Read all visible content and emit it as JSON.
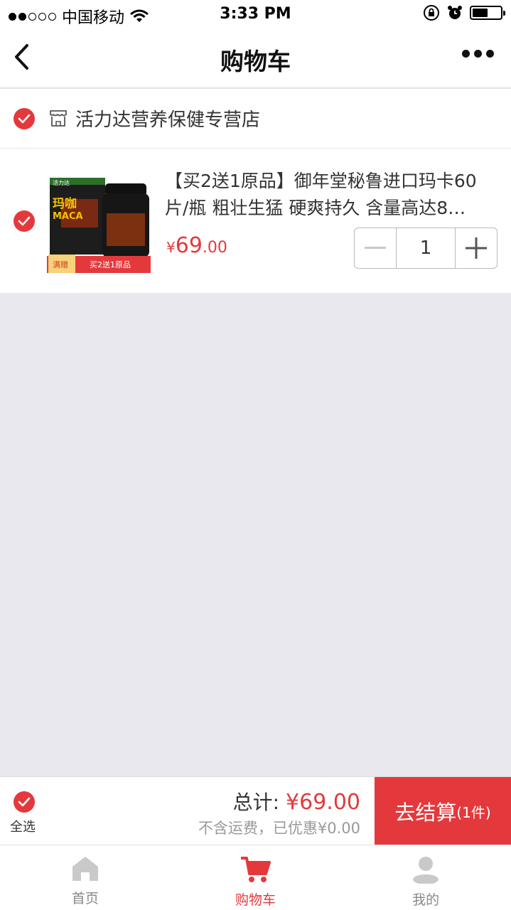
{
  "status_bar": {
    "carrier": "中国移动",
    "time": "3:33 PM"
  },
  "nav": {
    "title": "购物车",
    "back_icon": "chevron-left-icon",
    "more_icon": "more-dots-icon"
  },
  "shop": {
    "name": "活力达营养保健专营店",
    "checked": true
  },
  "item": {
    "title": "【买2送1原品】御年堂秘鲁进口玛卡60片/瓶 粗壮生猛 硬爽持久 含量高达8…",
    "price_symbol": "¥",
    "price_integer": "69",
    "price_decimal": ".00",
    "quantity": "1",
    "checked": true,
    "thumb_text": {
      "brand": "活力达",
      "product": "玛咖",
      "product_en": "MACA",
      "badge": "满赠",
      "promo": "买2送1原品"
    }
  },
  "checkout": {
    "select_all_label": "全选",
    "total_label": "总计:",
    "total_amount": "¥69.00",
    "sub_text": "不含运费，已优惠¥0.00",
    "button_label": "去结算",
    "button_count": "(1件)"
  },
  "tabs": [
    {
      "label": "首页",
      "icon": "home-icon",
      "active": false
    },
    {
      "label": "购物车",
      "icon": "cart-icon",
      "active": true
    },
    {
      "label": "我的",
      "icon": "user-icon",
      "active": false
    }
  ],
  "colors": {
    "accent": "#e4393c",
    "background": "#e8e8ee",
    "tab_inactive": "#888888"
  }
}
